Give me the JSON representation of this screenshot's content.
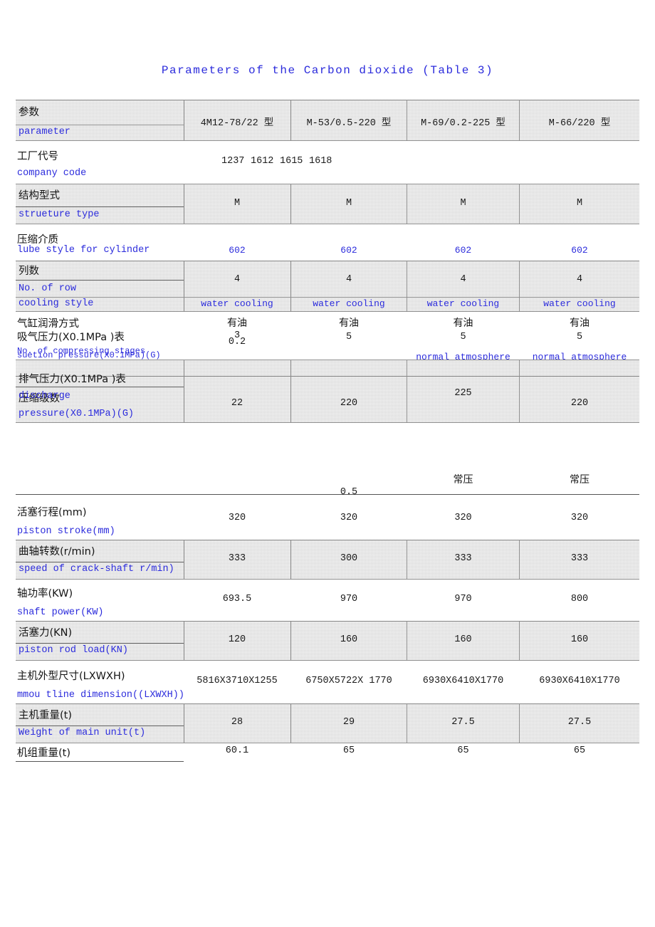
{
  "document": {
    "title": "Parameters of the Carbon dioxide (Table 3)"
  },
  "table": {
    "header": {
      "param_cn": "参数",
      "param_en": "parameter",
      "models": [
        "4M12-78/22 型",
        "M-53/0.5-220 型",
        "M-69/0.2-225 型",
        "M-66/220 型"
      ]
    },
    "rows": [
      {
        "label_cn": "工厂代号",
        "label_en": "company code",
        "values": [
          "1237",
          "1612",
          "1615",
          "1618"
        ],
        "shaded": false
      },
      {
        "label_cn": "结构型式",
        "label_en": "strueture type",
        "values": [
          "M",
          "M",
          "M",
          "M"
        ],
        "shaded": true
      },
      {
        "label_cn": "压缩介质",
        "label_en": "lube style for cylinder",
        "values": [
          "602",
          "602",
          "602",
          "602"
        ],
        "shaded": false
      },
      {
        "label_cn": "列数",
        "label_en": "No. of row",
        "values": [
          "4",
          "4",
          "4",
          "4"
        ],
        "shaded": true
      },
      {
        "label_cn": "",
        "label_en": "cooling style",
        "values": [
          "water cooling",
          "water cooling",
          "water cooling",
          "water cooling"
        ],
        "shaded": true
      },
      {
        "label_cn": "气缸润滑方式",
        "label_en": "No. of compressing stages",
        "values": [
          "有油",
          "有油",
          "有油",
          "有油"
        ],
        "shaded": false
      },
      {
        "label_cn": "吸气压力(X0.1MPa )表",
        "label_en": "suetion pressure(X0.1MPa)(G)",
        "values": [
          "3",
          "5",
          "5",
          "5"
        ],
        "shaded": false
      },
      {
        "label_cn": "",
        "label_en": "",
        "values": [
          "0.2",
          "",
          "normal atmosphere",
          "normal atmosphere"
        ],
        "shaded": false
      },
      {
        "label_cn": "排气压力(X0.1MPa )表",
        "label_en": "pressure(X0.1MPa)(G)",
        "label_cn2": "压缩级数",
        "label_en2": "discharge",
        "values": [
          "22",
          "220",
          "225",
          "220"
        ],
        "shaded": true
      },
      {
        "label_cn": "",
        "label_en": "",
        "values": [
          "",
          "0.5",
          "常压",
          "常压"
        ],
        "shaded": false
      },
      {
        "label_cn": "活塞行程(mm)",
        "label_en": "piston stroke(mm)",
        "values": [
          "320",
          "320",
          "320",
          "320"
        ],
        "shaded": false
      },
      {
        "label_cn": "曲轴转数(r/min)",
        "label_en": "speed of crack-shaft r/min)",
        "values": [
          "333",
          "300",
          "333",
          "333"
        ],
        "shaded": true
      },
      {
        "label_cn": "轴功率(KW)",
        "label_en": "shaft power(KW)",
        "values": [
          "693.5",
          "970",
          "970",
          "800"
        ],
        "shaded": false
      },
      {
        "label_cn": "活塞力(KN)",
        "label_en": "piston rod load(KN)",
        "values": [
          "120",
          "160",
          "160",
          "160"
        ],
        "shaded": true
      },
      {
        "label_cn": "主机外型尺寸(LXWXH)",
        "label_en": "mmou tline dimension((LXWXH))",
        "values": [
          "5816X3710X1255",
          "6750X5722X 1770",
          "6930X6410X1770",
          "6930X6410X1770"
        ],
        "shaded": false
      },
      {
        "label_cn": "主机重量(t)",
        "label_en": "Weight of main unit(t)",
        "values": [
          "28",
          "29",
          "27.5",
          "27.5"
        ],
        "shaded": true
      },
      {
        "label_cn": "机组重量(t)",
        "label_en": "",
        "values": [
          "60.1",
          "65",
          "65",
          "65"
        ],
        "shaded": false
      }
    ]
  },
  "colors": {
    "accent_blue": "#2b2bdc",
    "cell_shade": "#d6d6d6",
    "rule": "#8d8d8d"
  }
}
